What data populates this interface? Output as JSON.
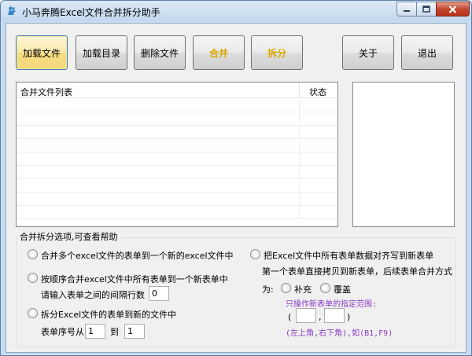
{
  "window": {
    "title": "小马奔腾Excel文件合并拆分助手"
  },
  "toolbar": {
    "load_file": "加载文件",
    "load_dir": "加载目录",
    "delete_file": "删除文件",
    "merge": "合并",
    "split": "拆分",
    "about": "关于",
    "exit": "退出"
  },
  "file_list": {
    "col_name": "合并文件列表",
    "col_status": "状态"
  },
  "options": {
    "group_title": "合并拆分选项,可查看帮助",
    "opt1": "合并多个excel文件的表单到一个新的excel文件中",
    "opt2": "按顺序合并excel文件中所有表单到一个新表单中",
    "opt2_sub": "请输入表单之间的间隔行数",
    "opt2_value": "0",
    "opt3": "拆分Excel文件的表单到新的文件中",
    "opt3_from_label": "表单序号从",
    "opt3_from_value": "1",
    "opt3_to_label": "到",
    "opt3_to_value": "1",
    "opt4": "把Excel文件中所有表单数据对齐写到新表单",
    "opt4_sub": "第一个表单直接拷贝到新表单，后续表单合并方式",
    "opt4_mode_label": "为:",
    "mode_fill": "补充",
    "mode_cover": "覆盖",
    "range_hint": "只操作新表单的指定范围:",
    "range_open": "(",
    "range_comma": ",",
    "range_close": ")",
    "range_example": "(左上角,右下角),如(B1,F9)"
  }
}
